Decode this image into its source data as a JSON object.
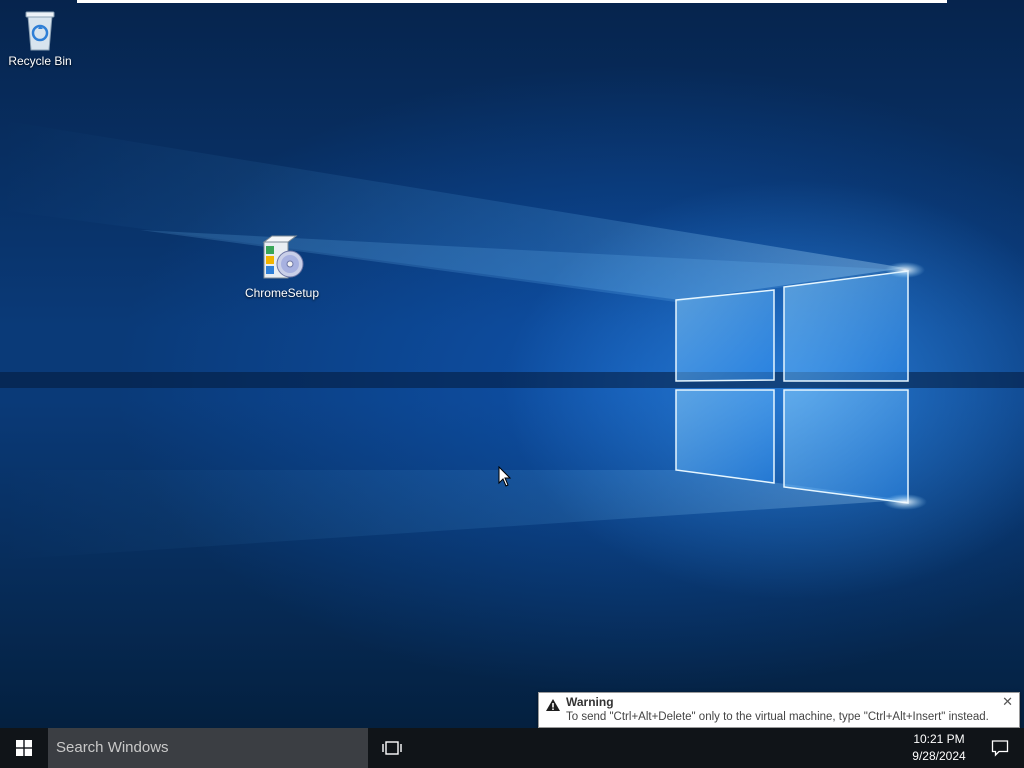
{
  "desktop": {
    "icons": [
      {
        "label": "Recycle Bin",
        "icon": "recycle-bin-icon"
      },
      {
        "label": "ChromeSetup",
        "icon": "installer-icon"
      }
    ],
    "wallpaper": "windows-10-hero",
    "accent_color": "#0a3a78"
  },
  "notification": {
    "title": "Warning",
    "message": "To send \"Ctrl+Alt+Delete\" only to the virtual machine, type \"Ctrl+Alt+Insert\" instead.",
    "icon": "warning-icon",
    "close_icon": "close-icon"
  },
  "taskbar": {
    "start_icon": "windows-logo-icon",
    "search_placeholder": "Search Windows",
    "taskview_icon": "task-view-icon",
    "time": "10:21 PM",
    "date": "9/28/2024",
    "action_center_icon": "action-center-icon",
    "background_color": "#101418"
  }
}
